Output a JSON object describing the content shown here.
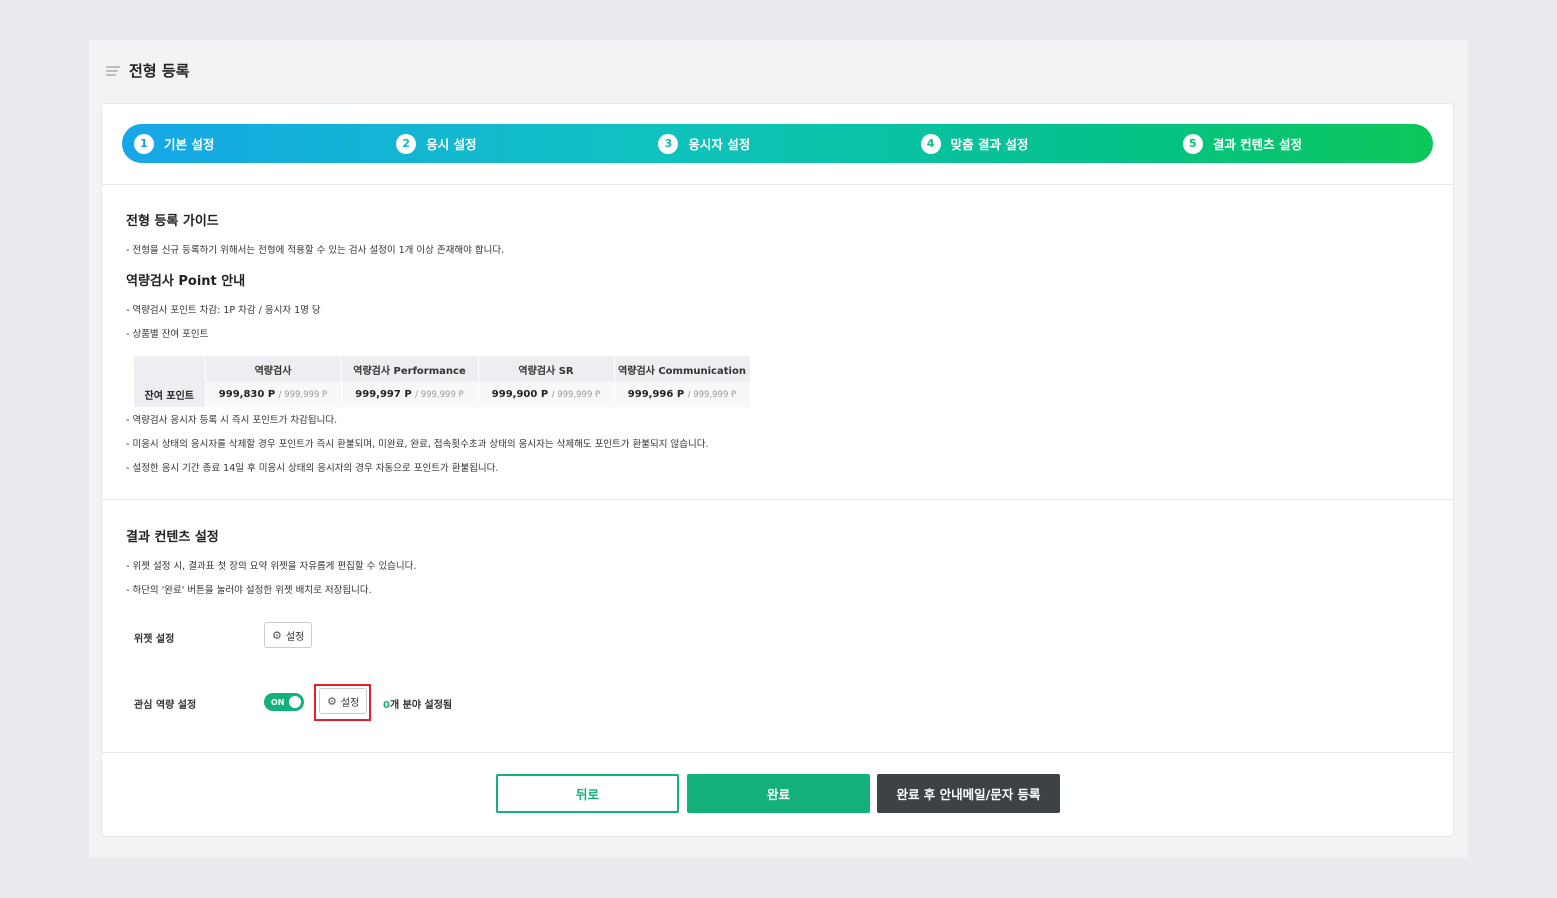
{
  "page": {
    "title": "전형 등록"
  },
  "steps": [
    {
      "num": "1",
      "label": "기본 설정"
    },
    {
      "num": "2",
      "label": "응시 설정"
    },
    {
      "num": "3",
      "label": "응시자 설정"
    },
    {
      "num": "4",
      "label": "맞춤 결과 설정"
    },
    {
      "num": "5",
      "label": "결과 컨텐츠 설정"
    }
  ],
  "guide": {
    "title": "전형 등록 가이드",
    "note1": "- 전형을 신규 등록하기 위해서는 전형에 적용할 수 있는 검사 설정이 1개 이상 존재해야 합니다.",
    "point_title": "역량검사 Point 안내",
    "point_note1": "- 역량검사 포인트 차감: 1P 차감 / 응시자 1명 당",
    "point_note2": "- 상품별 잔여 포인트",
    "table": {
      "headers": [
        "역량검사",
        "역량검사 Performance",
        "역량검사 SR",
        "역량검사 Communication"
      ],
      "row_label": "잔여 포인트",
      "values": [
        "999,830 P",
        "999,997 P",
        "999,900 P",
        "999,996 P"
      ],
      "maxes": [
        "/ 999,999 P",
        "/ 999,999 P",
        "/ 999,999 P",
        "/ 999,999 P"
      ]
    },
    "note2": "- 역량검사 응시자 등록 시 즉시 포인트가 차감됩니다.",
    "note3": "- 미응시 상태의 응시자를 삭제할 경우 포인트가 즉시 환불되며, 미완료, 완료, 접속횟수초과 상태의 응시자는 삭제해도 포인트가 환불되지 않습니다.",
    "note4": "- 설정한 응시 기간 종료 14일 후 미응시 상태의 응시자의 경우 자동으로 포인트가 환불됩니다."
  },
  "result": {
    "title": "결과 컨텐츠 설정",
    "note1": "- 위젯 설정 시, 결과표 첫 장의 요약 위젯을 자유롭게 편집할 수 있습니다.",
    "note2": "- 하단의 '완료' 버튼을 눌러야 설정한 위젯 배치로 저장됩니다.",
    "widget_label": "위젯 설정",
    "setting_label": "설정",
    "interest_label": "관심 역량 설정",
    "toggle_label": "ON",
    "count_zero": "0",
    "count_suffix": "개 분야 설정됨"
  },
  "buttons": {
    "back": "뒤로",
    "done": "완료",
    "done_mail": "완료 후 안내메일/문자 등록"
  },
  "colors": {
    "accent": "#13b07a",
    "highlight": "#e0202a",
    "dark_button": "#3d4247"
  }
}
